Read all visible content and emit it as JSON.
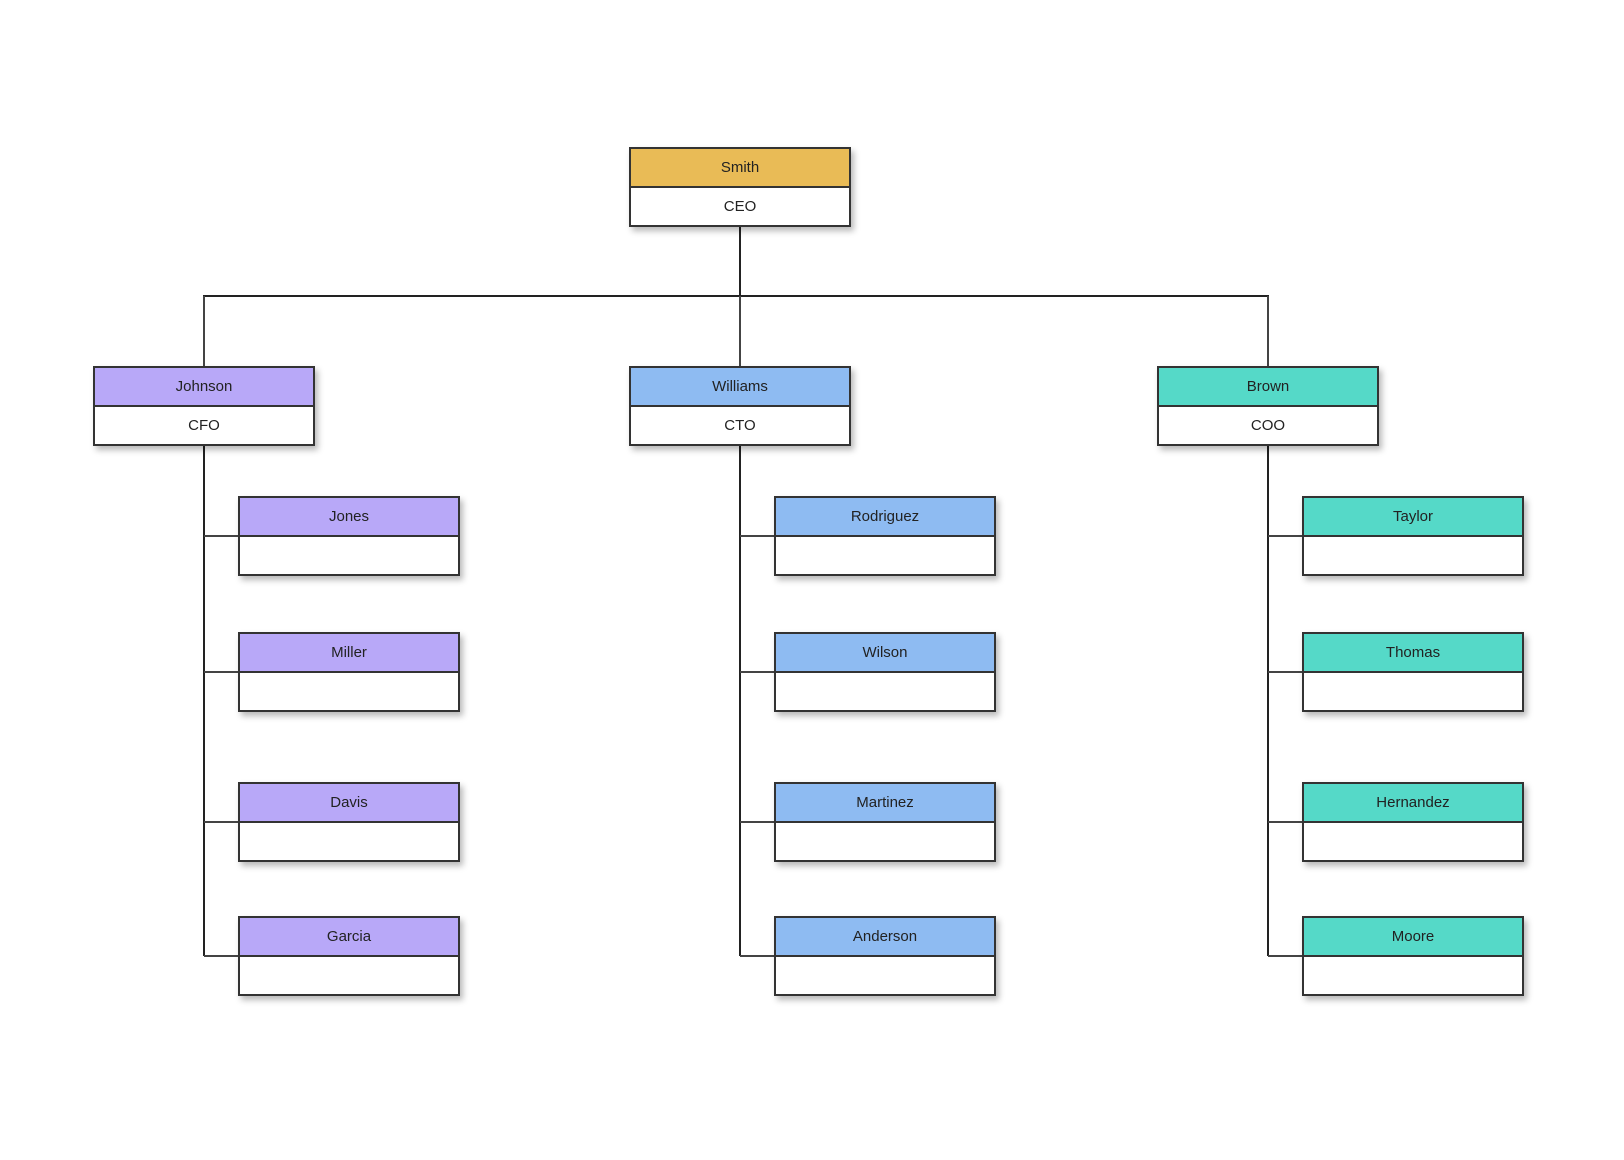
{
  "diagram": {
    "type": "org-chart",
    "root": {
      "name": "Smith",
      "title": "CEO",
      "color": "#E9BB56",
      "children": [
        {
          "name": "Johnson",
          "title": "CFO",
          "color": "#B8A8F8",
          "children": [
            {
              "name": "Jones",
              "title": ""
            },
            {
              "name": "Miller",
              "title": ""
            },
            {
              "name": "Davis",
              "title": ""
            },
            {
              "name": "Garcia",
              "title": ""
            }
          ]
        },
        {
          "name": "Williams",
          "title": "CTO",
          "color": "#8EBBF2",
          "children": [
            {
              "name": "Rodriguez",
              "title": ""
            },
            {
              "name": "Wilson",
              "title": ""
            },
            {
              "name": "Martinez",
              "title": ""
            },
            {
              "name": "Anderson",
              "title": ""
            }
          ]
        },
        {
          "name": "Brown",
          "title": "COO",
          "color": "#55D9C8",
          "children": [
            {
              "name": "Taylor",
              "title": ""
            },
            {
              "name": "Thomas",
              "title": ""
            },
            {
              "name": "Hernandez",
              "title": ""
            },
            {
              "name": "Moore",
              "title": ""
            }
          ]
        }
      ]
    }
  }
}
